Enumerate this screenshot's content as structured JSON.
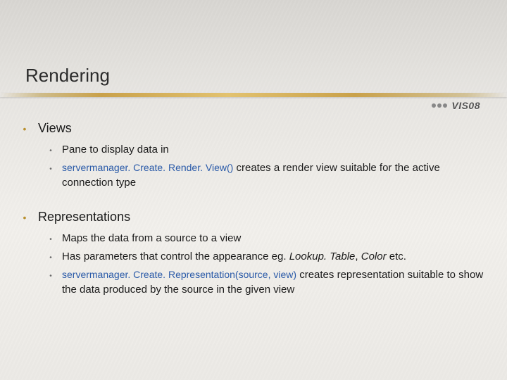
{
  "title": "Rendering",
  "logo": "VIS08",
  "sections": [
    {
      "heading": "Views",
      "items": [
        {
          "plain": "Pane to display data in"
        },
        {
          "code": "servermanager. Create. Render. View()",
          "rest": " creates a render view suitable for the active connection type"
        }
      ]
    },
    {
      "heading": "Representations",
      "items": [
        {
          "plain": "Maps the data from a source to a view"
        },
        {
          "plainPrefix": "Has parameters that control the appearance eg. ",
          "ital1": "Lookup. Table",
          "mid": ", ",
          "ital2": "Color ",
          "plainSuffix": "etc."
        },
        {
          "code": "servermanager. Create. Representation(source, view)",
          "rest": " creates representation suitable to show the data produced by the source in the given view"
        }
      ]
    }
  ]
}
